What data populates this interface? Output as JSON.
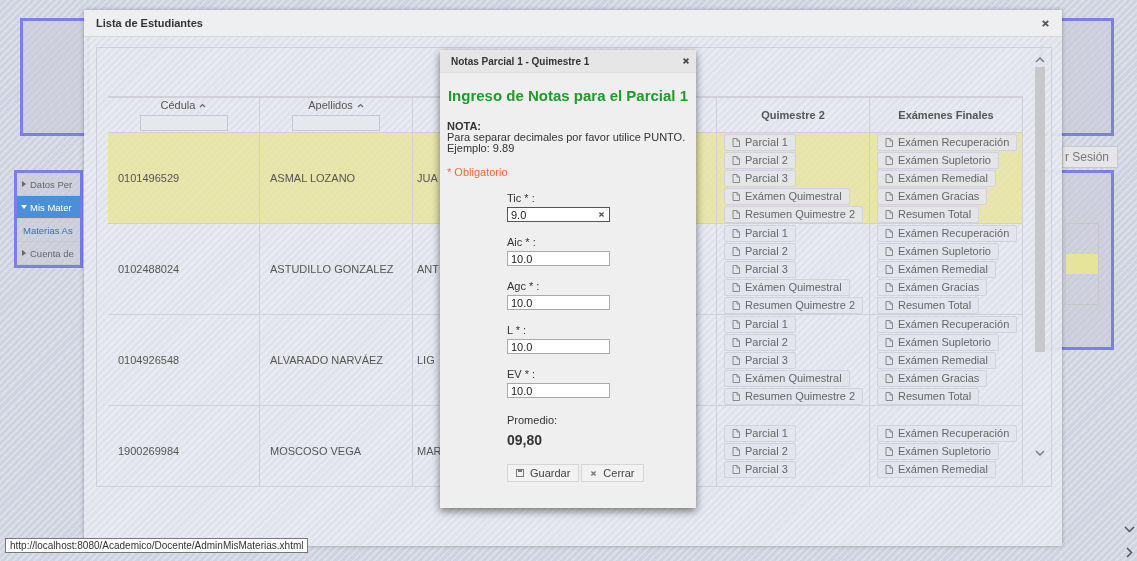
{
  "page": {
    "sidebar": {
      "items": [
        {
          "label": "Datos Per",
          "expanded": false,
          "selected": false
        },
        {
          "label": "Mis Mater",
          "expanded": true,
          "selected": true,
          "children": [
            {
              "label": "Materias As",
              "selected": false
            }
          ]
        },
        {
          "label": "Cuenta de",
          "expanded": false,
          "selected": false
        }
      ]
    },
    "session_button": "r Sesión",
    "status_url": "http://localhost:8080/Academico/Docente/AdminMisMaterias.xhtml"
  },
  "students_dialog": {
    "title": "Lista de Estudiantes",
    "columns": [
      {
        "label": "Cédula",
        "kind": "filter"
      },
      {
        "label": "Apellidos",
        "kind": "filter"
      },
      {
        "label": "Quimestre 2",
        "kind": "plain"
      },
      {
        "label": "Exámenes Finales",
        "kind": "plain"
      }
    ],
    "rows": [
      {
        "cedula": "0101496529",
        "apellidos": "ASMAL LOZANO",
        "nombres": "JUA",
        "selected": true,
        "quimestre_2": [
          "Parcial 1",
          "Parcial 2",
          "Parcial 3",
          "Exámen Quimestral",
          "Resumen Quimestre 2"
        ],
        "examenes_finales": [
          "Exámen Recuperación",
          "Exámen Supletorio",
          "Exámen Remedial",
          "Exámen Gracias",
          "Resumen Total"
        ]
      },
      {
        "cedula": "0102488024",
        "apellidos": "ASTUDILLO GONZALEZ",
        "nombres": "ANT",
        "selected": false,
        "quimestre_2": [
          "Parcial 1",
          "Parcial 2",
          "Parcial 3",
          "Exámen Quimestral",
          "Resumen Quimestre 2"
        ],
        "examenes_finales": [
          "Exámen Recuperación",
          "Exámen Supletorio",
          "Exámen Remedial",
          "Exámen Gracias",
          "Resumen Total"
        ]
      },
      {
        "cedula": "0104926548",
        "apellidos": "ALVARADO NARVÁEZ",
        "nombres": "LIG",
        "selected": false,
        "quimestre_2": [
          "Parcial 1",
          "Parcial 2",
          "Parcial 3",
          "Exámen Quimestral",
          "Resumen Quimestre 2"
        ],
        "examenes_finales": [
          "Exámen Recuperación",
          "Exámen Supletorio",
          "Exámen Remedial",
          "Exámen Gracias",
          "Resumen Total"
        ]
      },
      {
        "cedula": "1900269984",
        "apellidos": "MOSCOSO VEGA",
        "nombres": "MAR",
        "selected": false,
        "quimestre_2": [
          "Parcial 1",
          "Parcial 2",
          "Parcial 3"
        ],
        "examenes_finales": [
          "Exámen Recuperación",
          "Exámen Supletorio",
          "Exámen Remedial"
        ]
      }
    ]
  },
  "grades_dialog": {
    "title": "Notas Parcial 1 - Quimestre 1",
    "heading": "Ingreso de Notas para el Parcial 1",
    "note_label": "NOTA:",
    "note_text": "Para separar decimales por favor utilice PUNTO. Ejemplo: 9.89",
    "required_hint": "* Obligatorio",
    "fields": [
      {
        "label": "Tic * :",
        "value": "9.0",
        "focused": true
      },
      {
        "label": "Aic * :",
        "value": "10.0",
        "focused": false
      },
      {
        "label": "Agc * :",
        "value": "10.0",
        "focused": false
      },
      {
        "label": "L * :",
        "value": "10.0",
        "focused": false
      },
      {
        "label": "EV * :",
        "value": "10.0",
        "focused": false
      }
    ],
    "average_label": "Promedio:",
    "average_value": "09,80",
    "buttons": [
      {
        "label": "Guardar",
        "kind": "save"
      },
      {
        "label": "Cerrar",
        "kind": "close"
      }
    ]
  }
}
